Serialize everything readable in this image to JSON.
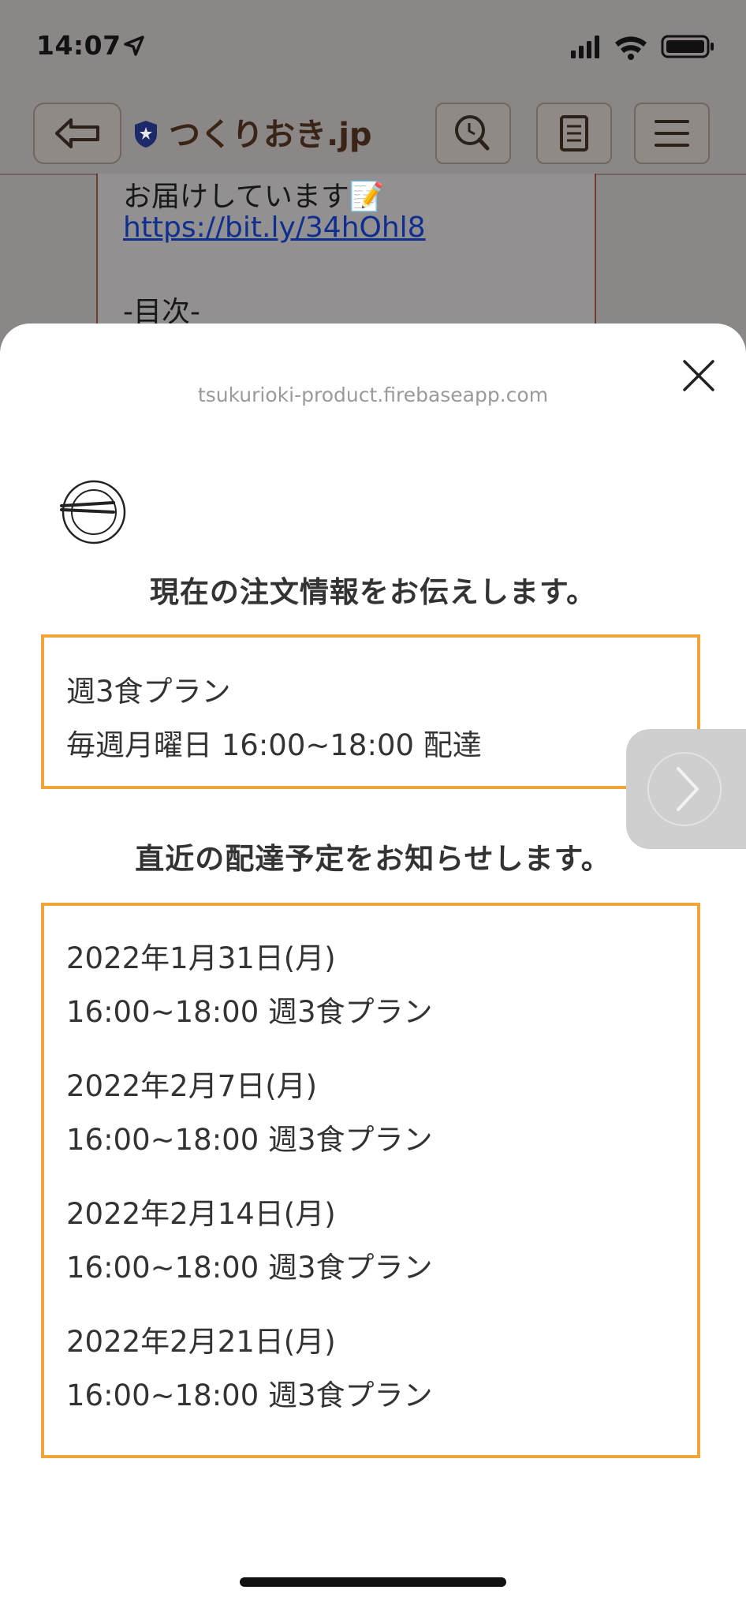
{
  "status_bar": {
    "time": "14:07"
  },
  "browser": {
    "site_title": "つくりおき.jp"
  },
  "background_page": {
    "line1": "お届けしています📝",
    "link": "https://bit.ly/34hOhl8",
    "line3": "-目次-"
  },
  "sheet": {
    "domain": "tsukurioki-product.firebaseapp.com",
    "order_heading": "現在の注文情報をお伝えします。",
    "order": {
      "plan": "週3食プラン",
      "schedule": "毎週月曜日 16:00~18:00 配達"
    },
    "delivery_heading": "直近の配達予定をお知らせします。",
    "deliveries": [
      {
        "date": "2022年1月31日(月)",
        "detail": "16:00~18:00 週3食プラン"
      },
      {
        "date": "2022年2月7日(月)",
        "detail": "16:00~18:00 週3食プラン"
      },
      {
        "date": "2022年2月14日(月)",
        "detail": "16:00~18:00 週3食プラン"
      },
      {
        "date": "2022年2月21日(月)",
        "detail": "16:00~18:00 週3食プラン"
      }
    ]
  },
  "colors": {
    "accent_border": "#f0a43a"
  }
}
